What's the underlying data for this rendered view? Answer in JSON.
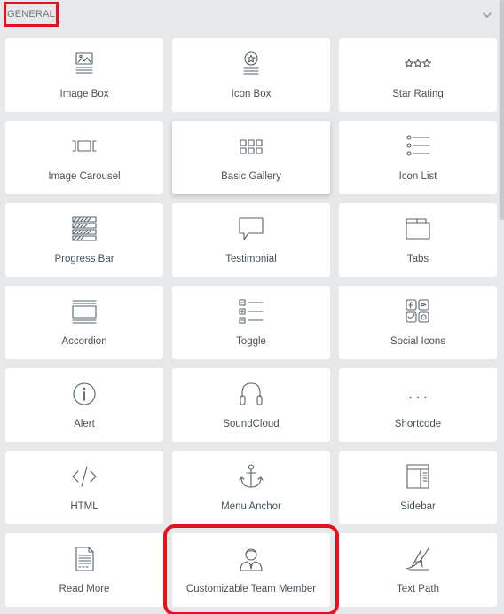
{
  "section": {
    "title": "GENERAL"
  },
  "widgets": [
    {
      "label": "Image Box",
      "icon": "image-box-icon"
    },
    {
      "label": "Icon Box",
      "icon": "icon-box-icon"
    },
    {
      "label": "Star Rating",
      "icon": "star-rating-icon"
    },
    {
      "label": "Image Carousel",
      "icon": "image-carousel-icon"
    },
    {
      "label": "Basic Gallery",
      "icon": "basic-gallery-icon"
    },
    {
      "label": "Icon List",
      "icon": "icon-list-icon"
    },
    {
      "label": "Progress Bar",
      "icon": "progress-bar-icon"
    },
    {
      "label": "Testimonial",
      "icon": "testimonial-icon"
    },
    {
      "label": "Tabs",
      "icon": "tabs-icon"
    },
    {
      "label": "Accordion",
      "icon": "accordion-icon"
    },
    {
      "label": "Toggle",
      "icon": "toggle-icon"
    },
    {
      "label": "Social Icons",
      "icon": "social-icons-icon"
    },
    {
      "label": "Alert",
      "icon": "alert-icon"
    },
    {
      "label": "SoundCloud",
      "icon": "soundcloud-icon"
    },
    {
      "label": "Shortcode",
      "icon": "shortcode-icon"
    },
    {
      "label": "HTML",
      "icon": "html-icon"
    },
    {
      "label": "Menu Anchor",
      "icon": "menu-anchor-icon"
    },
    {
      "label": "Sidebar",
      "icon": "sidebar-icon"
    },
    {
      "label": "Read More",
      "icon": "read-more-icon"
    },
    {
      "label": "Customizable Team Member",
      "icon": "team-member-icon"
    },
    {
      "label": "Text Path",
      "icon": "text-path-icon"
    }
  ],
  "shortcode_glyph": "[...]",
  "colors": {
    "highlight": "#e8101f",
    "background": "#e6e8ea",
    "tile": "#ffffff",
    "text": "#495157"
  }
}
